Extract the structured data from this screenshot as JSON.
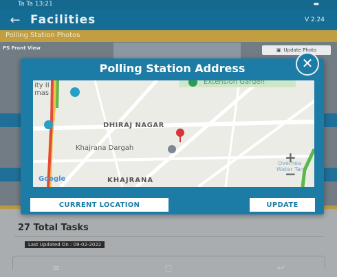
{
  "status_bar": {
    "left": "Ta Ta 13:21",
    "right": ""
  },
  "app_bar": {
    "back": "←",
    "title": "Facilities",
    "version": "V 2.24"
  },
  "section": {
    "title": "Polling Station Photos"
  },
  "photo": {
    "label": "PS Front View",
    "update_button": "Update Photo"
  },
  "modal": {
    "title": "Polling Station Address",
    "close": "✕",
    "map": {
      "labels": {
        "area_topleft": "ity II",
        "area_topleft2": "mas",
        "garden": "Extension Garden",
        "dhiraj": "DHIRAJ NAGAR",
        "dargah": "Khajrana Dargah",
        "overhead1": "Overhea",
        "overhead2": "Water Tan",
        "google": "Google",
        "khajrana": "KHAJRANA",
        "zoom_in": "+",
        "zoom_out": "−"
      }
    },
    "current_location": "CURRENT LOCATION",
    "update": "UPDATE"
  },
  "tasks": {
    "total": "27 Total Tasks",
    "last_updated": "Last Updated On : 09-02-2022"
  },
  "nav": {
    "menu": "≡",
    "home": "◻",
    "back": "↩"
  }
}
